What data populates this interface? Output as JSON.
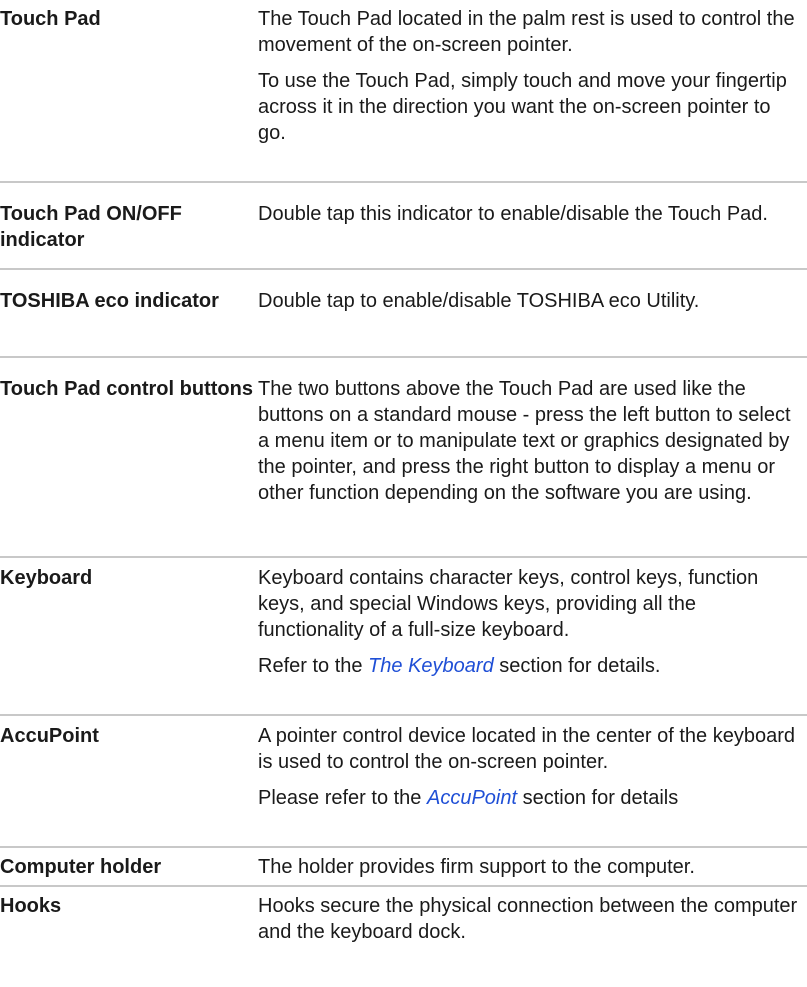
{
  "rows": [
    {
      "term": "Touch Pad",
      "paragraphs": [
        {
          "text": "The Touch Pad located in the palm rest is used to control the movement of the on-screen pointer."
        },
        {
          "text": "To use the Touch Pad, simply touch and move your fingertip across it in the direction you want the on-screen pointer to go."
        }
      ]
    },
    {
      "term": "Touch Pad ON/OFF indicator",
      "paragraphs": [
        {
          "text": "Double tap this indicator to enable/disable the Touch Pad."
        }
      ]
    },
    {
      "term": "TOSHIBA eco indicator",
      "paragraphs": [
        {
          "text": "Double tap to enable/disable TOSHIBA eco Utility."
        }
      ]
    },
    {
      "term": "Touch Pad control buttons",
      "paragraphs": [
        {
          "text": "The two buttons above the Touch Pad are used like the buttons on a standard mouse - press the left button to select a menu item or to manipulate text or graphics designated by the pointer, and press the right button to display a menu or other function depending on the software you are using."
        }
      ]
    },
    {
      "term": "Keyboard",
      "paragraphs": [
        {
          "text": "Keyboard contains character keys, control keys, function keys, and special Windows keys, providing all the functionality of a full-size keyboard."
        },
        {
          "before": "Refer to the ",
          "link": "The Keyboard",
          "after": " section for details."
        }
      ]
    },
    {
      "term": "AccuPoint",
      "paragraphs": [
        {
          "text": "A pointer control device located in the center of the keyboard is used to control the on-screen pointer."
        },
        {
          "before": "Please refer to the ",
          "link": "AccuPoint",
          "after": " section for details"
        }
      ]
    },
    {
      "term": "Computer holder",
      "paragraphs": [
        {
          "text": "The holder provides firm support to the computer."
        }
      ]
    },
    {
      "term": "Hooks",
      "paragraphs": [
        {
          "text": "Hooks secure the physical connection between the computer and the keyboard dock."
        }
      ]
    }
  ]
}
